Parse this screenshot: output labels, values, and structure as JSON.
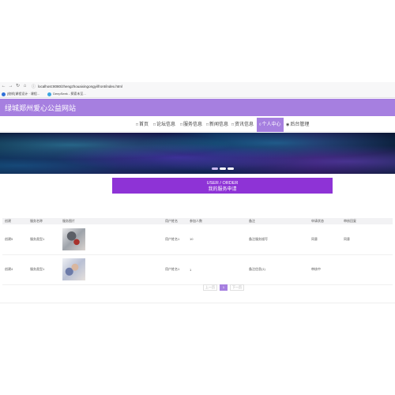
{
  "browser": {
    "url": "localhost:8080/zhengzhouaixingongyi/front/index.html",
    "tabs": [
      {
        "label": "[校样]课程设计 · 课程..."
      },
      {
        "label": "DeepSeek - 探索未至..."
      }
    ]
  },
  "site": {
    "title": "绿城郑州爱心公益网站"
  },
  "nav": {
    "items": [
      {
        "icon": "□",
        "label": "首页"
      },
      {
        "icon": "□",
        "label": "论坛信息"
      },
      {
        "icon": "□",
        "label": "服务信息"
      },
      {
        "icon": "□",
        "label": "新闻信息"
      },
      {
        "icon": "□",
        "label": "资讯信息"
      },
      {
        "icon": "◊",
        "label": "个人中心"
      },
      {
        "icon": "◉",
        "label": "后台管理"
      }
    ]
  },
  "section": {
    "title_en": "USER / ORDER",
    "title_cn": "我的服务申请"
  },
  "table": {
    "headers": [
      "创建",
      "服务名称",
      "服务图片",
      "",
      "用户姓名",
      "参加人数",
      "备注",
      "申请状态",
      "审核回复"
    ],
    "rows": [
      {
        "id": "创建5",
        "name": "服务类型1",
        "user": "用户姓名1",
        "count": "10",
        "remark": "备注服务描写",
        "status": "同意",
        "reply": "同意"
      },
      {
        "id": "创建4",
        "name": "服务类型1",
        "user": "用户姓名1",
        "count": "1",
        "remark": "备注信息(1)",
        "status": "审核中",
        "reply": ""
      }
    ]
  },
  "pagination": {
    "prev": "上一页",
    "current": "1",
    "next": "下一页"
  },
  "colors": {
    "accent": "#a67fe0",
    "section_bar": "#8e33d6"
  }
}
